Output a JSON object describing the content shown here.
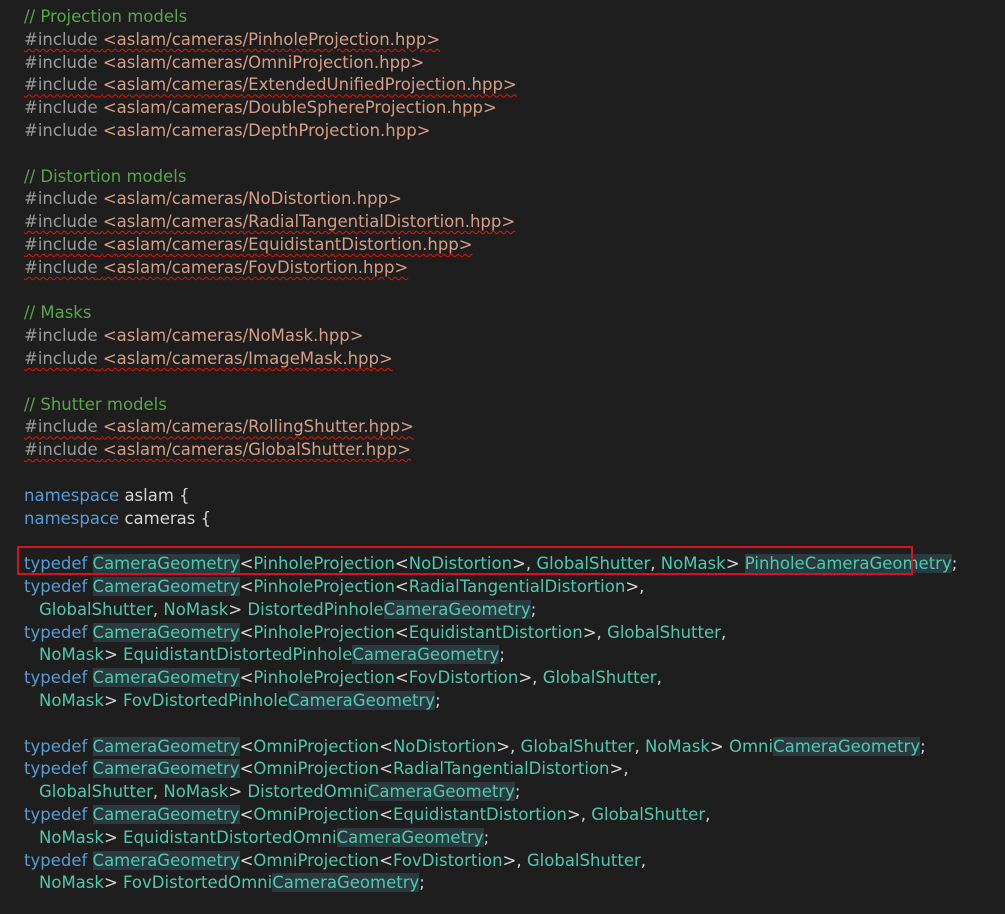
{
  "code_lines": [
    {
      "blank": false,
      "indent": false,
      "tokens": [
        {
          "text": "// Projection models",
          "cls": "t-comment"
        }
      ]
    },
    {
      "blank": false,
      "indent": false,
      "tokens": [
        {
          "text": "#include",
          "cls": "t-pp squig"
        },
        {
          "text": " ",
          "cls": "t-plain squig"
        },
        {
          "text": "<aslam/cameras/PinholeProjection.hpp>",
          "cls": "t-str squig"
        }
      ]
    },
    {
      "blank": false,
      "indent": false,
      "tokens": [
        {
          "text": "#include",
          "cls": "t-pp"
        },
        {
          "text": " ",
          "cls": "t-plain"
        },
        {
          "text": "<aslam/cameras/OmniProjection.hpp>",
          "cls": "t-str"
        }
      ]
    },
    {
      "blank": false,
      "indent": false,
      "tokens": [
        {
          "text": "#include",
          "cls": "t-pp squig"
        },
        {
          "text": " ",
          "cls": "t-plain squig"
        },
        {
          "text": "<aslam/cameras/ExtendedUnifiedProjection.hpp>",
          "cls": "t-str squig"
        }
      ]
    },
    {
      "blank": false,
      "indent": false,
      "tokens": [
        {
          "text": "#include",
          "cls": "t-pp"
        },
        {
          "text": " ",
          "cls": "t-plain"
        },
        {
          "text": "<aslam/cameras/DoubleSphereProjection.hpp>",
          "cls": "t-str"
        }
      ]
    },
    {
      "blank": false,
      "indent": false,
      "tokens": [
        {
          "text": "#include",
          "cls": "t-pp"
        },
        {
          "text": " ",
          "cls": "t-plain"
        },
        {
          "text": "<aslam/cameras/DepthProjection.hpp>",
          "cls": "t-str"
        }
      ]
    },
    {
      "blank": true
    },
    {
      "blank": false,
      "indent": false,
      "tokens": [
        {
          "text": "// Distortion models",
          "cls": "t-comment"
        }
      ]
    },
    {
      "blank": false,
      "indent": false,
      "tokens": [
        {
          "text": "#include",
          "cls": "t-pp"
        },
        {
          "text": " ",
          "cls": "t-plain"
        },
        {
          "text": "<aslam/cameras/NoDistortion.hpp>",
          "cls": "t-str"
        }
      ]
    },
    {
      "blank": false,
      "indent": false,
      "tokens": [
        {
          "text": "#include",
          "cls": "t-pp squig"
        },
        {
          "text": " ",
          "cls": "t-plain squig"
        },
        {
          "text": "<aslam/cameras/RadialTangentialDistortion.hpp>",
          "cls": "t-str squig"
        }
      ]
    },
    {
      "blank": false,
      "indent": false,
      "tokens": [
        {
          "text": "#include",
          "cls": "t-pp squig"
        },
        {
          "text": " ",
          "cls": "t-plain squig"
        },
        {
          "text": "<aslam/cameras/EquidistantDistortion.hpp>",
          "cls": "t-str squig"
        }
      ]
    },
    {
      "blank": false,
      "indent": false,
      "tokens": [
        {
          "text": "#include",
          "cls": "t-pp squig"
        },
        {
          "text": " ",
          "cls": "t-plain squig"
        },
        {
          "text": "<aslam/cameras/FovDistortion.hpp>",
          "cls": "t-str squig"
        }
      ]
    },
    {
      "blank": true
    },
    {
      "blank": false,
      "indent": false,
      "tokens": [
        {
          "text": "// Masks",
          "cls": "t-comment"
        }
      ]
    },
    {
      "blank": false,
      "indent": false,
      "tokens": [
        {
          "text": "#include",
          "cls": "t-pp"
        },
        {
          "text": " ",
          "cls": "t-plain"
        },
        {
          "text": "<aslam/cameras/NoMask.hpp>",
          "cls": "t-str"
        }
      ]
    },
    {
      "blank": false,
      "indent": false,
      "tokens": [
        {
          "text": "#include",
          "cls": "t-pp squig"
        },
        {
          "text": " ",
          "cls": "t-plain squig"
        },
        {
          "text": "<aslam/cameras/ImageMask.hpp>",
          "cls": "t-str squig"
        }
      ]
    },
    {
      "blank": true
    },
    {
      "blank": false,
      "indent": false,
      "tokens": [
        {
          "text": "// Shutter models",
          "cls": "t-comment"
        }
      ]
    },
    {
      "blank": false,
      "indent": false,
      "tokens": [
        {
          "text": "#include",
          "cls": "t-pp squig"
        },
        {
          "text": " ",
          "cls": "t-plain squig"
        },
        {
          "text": "<aslam/cameras/RollingShutter.hpp>",
          "cls": "t-str squig"
        }
      ]
    },
    {
      "blank": false,
      "indent": false,
      "tokens": [
        {
          "text": "#include",
          "cls": "t-pp squig"
        },
        {
          "text": " ",
          "cls": "t-plain squig"
        },
        {
          "text": "<aslam/cameras/GlobalShutter.hpp>",
          "cls": "t-str squig"
        }
      ]
    },
    {
      "blank": true
    },
    {
      "blank": false,
      "indent": false,
      "tokens": [
        {
          "text": "namespace",
          "cls": "t-kw"
        },
        {
          "text": " aslam {",
          "cls": "t-plain"
        }
      ]
    },
    {
      "blank": false,
      "indent": false,
      "tokens": [
        {
          "text": "namespace",
          "cls": "t-kw"
        },
        {
          "text": " cameras {",
          "cls": "t-plain"
        }
      ]
    },
    {
      "blank": true
    },
    {
      "blank": false,
      "indent": false,
      "tokens": [
        {
          "text": "typedef",
          "cls": "t-kw"
        },
        {
          "text": " ",
          "cls": "t-plain"
        },
        {
          "text": "CameraGeometry",
          "cls": "t-ty t-hl"
        },
        {
          "text": "<",
          "cls": "t-plain"
        },
        {
          "text": "PinholeProjection",
          "cls": "t-ty"
        },
        {
          "text": "<",
          "cls": "t-plain"
        },
        {
          "text": "NoDistortion",
          "cls": "t-ty"
        },
        {
          "text": ">, ",
          "cls": "t-plain"
        },
        {
          "text": "GlobalShutter",
          "cls": "t-ty"
        },
        {
          "text": ", ",
          "cls": "t-plain"
        },
        {
          "text": "NoMask",
          "cls": "t-ty"
        },
        {
          "text": "> ",
          "cls": "t-plain"
        },
        {
          "text": "PinholeCameraGeometry",
          "cls": "t-ty t-hl"
        },
        {
          "text": ";",
          "cls": "t-plain"
        }
      ]
    },
    {
      "blank": false,
      "indent": false,
      "tokens": [
        {
          "text": "typedef",
          "cls": "t-kw"
        },
        {
          "text": " ",
          "cls": "t-plain"
        },
        {
          "text": "CameraGeometry",
          "cls": "t-ty t-hl"
        },
        {
          "text": "<",
          "cls": "t-plain"
        },
        {
          "text": "PinholeProjection",
          "cls": "t-ty"
        },
        {
          "text": "<",
          "cls": "t-plain"
        },
        {
          "text": "RadialTangentialDistortion",
          "cls": "t-ty"
        },
        {
          "text": ">,",
          "cls": "t-plain"
        }
      ]
    },
    {
      "blank": false,
      "indent": true,
      "tokens": [
        {
          "text": "GlobalShutter",
          "cls": "t-ty"
        },
        {
          "text": ", ",
          "cls": "t-plain"
        },
        {
          "text": "NoMask",
          "cls": "t-ty"
        },
        {
          "text": "> ",
          "cls": "t-plain"
        },
        {
          "text": "DistortedPinhole",
          "cls": "t-ty"
        },
        {
          "text": "CameraGeometry",
          "cls": "t-ty t-hl"
        },
        {
          "text": ";",
          "cls": "t-plain"
        }
      ]
    },
    {
      "blank": false,
      "indent": false,
      "tokens": [
        {
          "text": "typedef",
          "cls": "t-kw"
        },
        {
          "text": " ",
          "cls": "t-plain"
        },
        {
          "text": "CameraGeometry",
          "cls": "t-ty t-hl"
        },
        {
          "text": "<",
          "cls": "t-plain"
        },
        {
          "text": "PinholeProjection",
          "cls": "t-ty"
        },
        {
          "text": "<",
          "cls": "t-plain"
        },
        {
          "text": "EquidistantDistortion",
          "cls": "t-ty"
        },
        {
          "text": ">, ",
          "cls": "t-plain"
        },
        {
          "text": "GlobalShutter",
          "cls": "t-ty"
        },
        {
          "text": ",",
          "cls": "t-plain"
        }
      ]
    },
    {
      "blank": false,
      "indent": true,
      "tokens": [
        {
          "text": "NoMask",
          "cls": "t-ty"
        },
        {
          "text": "> ",
          "cls": "t-plain"
        },
        {
          "text": "EquidistantDistortedPinhole",
          "cls": "t-ty"
        },
        {
          "text": "CameraGeometry",
          "cls": "t-ty t-hl"
        },
        {
          "text": ";",
          "cls": "t-plain"
        }
      ]
    },
    {
      "blank": false,
      "indent": false,
      "tokens": [
        {
          "text": "typedef",
          "cls": "t-kw"
        },
        {
          "text": " ",
          "cls": "t-plain"
        },
        {
          "text": "CameraGeometry",
          "cls": "t-ty t-hl"
        },
        {
          "text": "<",
          "cls": "t-plain"
        },
        {
          "text": "PinholeProjection",
          "cls": "t-ty"
        },
        {
          "text": "<",
          "cls": "t-plain"
        },
        {
          "text": "FovDistortion",
          "cls": "t-ty"
        },
        {
          "text": ">, ",
          "cls": "t-plain"
        },
        {
          "text": "GlobalShutter",
          "cls": "t-ty"
        },
        {
          "text": ",",
          "cls": "t-plain"
        }
      ]
    },
    {
      "blank": false,
      "indent": true,
      "tokens": [
        {
          "text": "NoMask",
          "cls": "t-ty"
        },
        {
          "text": "> ",
          "cls": "t-plain"
        },
        {
          "text": "FovDistortedPinhole",
          "cls": "t-ty"
        },
        {
          "text": "CameraGeometry",
          "cls": "t-ty t-hl"
        },
        {
          "text": ";",
          "cls": "t-plain"
        }
      ]
    },
    {
      "blank": true
    },
    {
      "blank": false,
      "indent": false,
      "tokens": [
        {
          "text": "typedef",
          "cls": "t-kw"
        },
        {
          "text": " ",
          "cls": "t-plain"
        },
        {
          "text": "CameraGeometry",
          "cls": "t-ty t-hl"
        },
        {
          "text": "<",
          "cls": "t-plain"
        },
        {
          "text": "OmniProjection",
          "cls": "t-ty"
        },
        {
          "text": "<",
          "cls": "t-plain"
        },
        {
          "text": "NoDistortion",
          "cls": "t-ty"
        },
        {
          "text": ">, ",
          "cls": "t-plain"
        },
        {
          "text": "GlobalShutter",
          "cls": "t-ty"
        },
        {
          "text": ", ",
          "cls": "t-plain"
        },
        {
          "text": "NoMask",
          "cls": "t-ty"
        },
        {
          "text": "> ",
          "cls": "t-plain"
        },
        {
          "text": "Omni",
          "cls": "t-ty"
        },
        {
          "text": "CameraGeometry",
          "cls": "t-ty t-hl"
        },
        {
          "text": ";",
          "cls": "t-plain"
        }
      ]
    },
    {
      "blank": false,
      "indent": false,
      "tokens": [
        {
          "text": "typedef",
          "cls": "t-kw"
        },
        {
          "text": " ",
          "cls": "t-plain"
        },
        {
          "text": "CameraGeometry",
          "cls": "t-ty t-hl"
        },
        {
          "text": "<",
          "cls": "t-plain"
        },
        {
          "text": "OmniProjection",
          "cls": "t-ty"
        },
        {
          "text": "<",
          "cls": "t-plain"
        },
        {
          "text": "RadialTangentialDistortion",
          "cls": "t-ty"
        },
        {
          "text": ">,",
          "cls": "t-plain"
        }
      ]
    },
    {
      "blank": false,
      "indent": true,
      "tokens": [
        {
          "text": "GlobalShutter",
          "cls": "t-ty"
        },
        {
          "text": ", ",
          "cls": "t-plain"
        },
        {
          "text": "NoMask",
          "cls": "t-ty"
        },
        {
          "text": "> ",
          "cls": "t-plain"
        },
        {
          "text": "DistortedOmni",
          "cls": "t-ty"
        },
        {
          "text": "CameraGeometry",
          "cls": "t-ty t-hl"
        },
        {
          "text": ";",
          "cls": "t-plain"
        }
      ]
    },
    {
      "blank": false,
      "indent": false,
      "tokens": [
        {
          "text": "typedef",
          "cls": "t-kw"
        },
        {
          "text": " ",
          "cls": "t-plain"
        },
        {
          "text": "CameraGeometry",
          "cls": "t-ty t-hl"
        },
        {
          "text": "<",
          "cls": "t-plain"
        },
        {
          "text": "OmniProjection",
          "cls": "t-ty"
        },
        {
          "text": "<",
          "cls": "t-plain"
        },
        {
          "text": "EquidistantDistortion",
          "cls": "t-ty"
        },
        {
          "text": ">, ",
          "cls": "t-plain"
        },
        {
          "text": "GlobalShutter",
          "cls": "t-ty"
        },
        {
          "text": ",",
          "cls": "t-plain"
        }
      ]
    },
    {
      "blank": false,
      "indent": true,
      "tokens": [
        {
          "text": "NoMask",
          "cls": "t-ty"
        },
        {
          "text": "> ",
          "cls": "t-plain"
        },
        {
          "text": "EquidistantDistortedOmni",
          "cls": "t-ty"
        },
        {
          "text": "CameraGeometry",
          "cls": "t-ty t-hl"
        },
        {
          "text": ";",
          "cls": "t-plain"
        }
      ]
    },
    {
      "blank": false,
      "indent": false,
      "tokens": [
        {
          "text": "typedef",
          "cls": "t-kw"
        },
        {
          "text": " ",
          "cls": "t-plain"
        },
        {
          "text": "CameraGeometry",
          "cls": "t-ty t-hl"
        },
        {
          "text": "<",
          "cls": "t-plain"
        },
        {
          "text": "OmniProjection",
          "cls": "t-ty"
        },
        {
          "text": "<",
          "cls": "t-plain"
        },
        {
          "text": "FovDistortion",
          "cls": "t-ty"
        },
        {
          "text": ">, ",
          "cls": "t-plain"
        },
        {
          "text": "GlobalShutter",
          "cls": "t-ty"
        },
        {
          "text": ",",
          "cls": "t-plain"
        }
      ]
    },
    {
      "blank": false,
      "indent": true,
      "tokens": [
        {
          "text": "NoMask",
          "cls": "t-ty"
        },
        {
          "text": "> ",
          "cls": "t-plain"
        },
        {
          "text": "FovDistortedOmni",
          "cls": "t-ty"
        },
        {
          "text": "CameraGeometry",
          "cls": "t-ty t-hl"
        },
        {
          "text": ";",
          "cls": "t-plain"
        }
      ]
    }
  ],
  "highlighted_line_index": 24,
  "colors": {
    "background": "#1e1e1e",
    "comment": "#57a64a",
    "keyword": "#569cd6",
    "type": "#4ec9b0",
    "string": "#d69d85",
    "preprocessor": "#9b9b9b",
    "highlight_box": "#d6131a",
    "error_squiggle": "#e51400"
  }
}
